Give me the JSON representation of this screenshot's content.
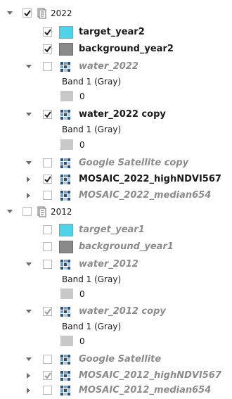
{
  "groups": [
    {
      "name": "2022",
      "checked": true,
      "layers": [
        {
          "name": "target_year2",
          "checked": true,
          "style": "bold",
          "swatch": "#4fd3e8"
        },
        {
          "name": "background_year2",
          "checked": true,
          "style": "bold",
          "swatch": "#8a8a8a"
        },
        {
          "name": "water_2022",
          "checked": false,
          "style": "dim",
          "band": "Band 1 (Gray)",
          "value": "0"
        },
        {
          "name": "water_2022 copy",
          "checked": true,
          "style": "bold",
          "band": "Band 1 (Gray)",
          "value": "0"
        },
        {
          "name": "Google Satellite copy",
          "checked": false,
          "style": "dim"
        },
        {
          "name": "MOSAIC_2022_highNDVI567",
          "checked": true,
          "style": "bold"
        },
        {
          "name": "MOSAIC_2022_median654",
          "checked": false,
          "style": "dim"
        }
      ]
    },
    {
      "name": "2012",
      "checked": false,
      "layers": [
        {
          "name": "target_year1",
          "checked": false,
          "style": "dim",
          "swatch": "#4fd3e8"
        },
        {
          "name": "background_year1",
          "checked": false,
          "style": "dim",
          "swatch": "#8a8a8a"
        },
        {
          "name": "water_2012",
          "checked": false,
          "style": "dim",
          "band": "Band 1 (Gray)",
          "value": "0"
        },
        {
          "name": "water_2012 copy",
          "checked": true,
          "style": "dim",
          "band": "Band 1 (Gray)",
          "value": "0"
        },
        {
          "name": "Google Satellite",
          "checked": false,
          "style": "dim"
        },
        {
          "name": "MOSAIC_2012_highNDVI567",
          "checked": true,
          "style": "dim"
        },
        {
          "name": "MOSAIC_2012_median654",
          "checked": false,
          "style": "dim"
        }
      ]
    }
  ],
  "colors": {
    "target_swatch": "#4fd3e8",
    "background_swatch": "#8a8a8a",
    "band_swatch": "#c8c8c8",
    "checkbox_border": "#b9b9b9",
    "checkmark": "#222222",
    "checkmark_dim": "#9a9a9a",
    "dim_text": "#8c8c8c"
  },
  "icons": {
    "group": "layer-group-icon",
    "raster": "raster-layer-icon",
    "expand_open": "chevron-down-icon",
    "expand_closed": "chevron-right-icon"
  }
}
